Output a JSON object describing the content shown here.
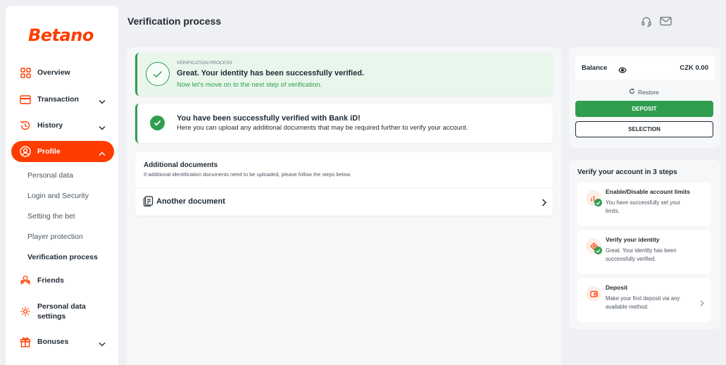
{
  "sidebar": {
    "logo": "Betano",
    "nav": [
      {
        "label": "Overview"
      },
      {
        "label": "Transaction"
      },
      {
        "label": "History"
      },
      {
        "label": "Profile"
      },
      {
        "label": "Friends"
      },
      {
        "label": "Personal data settings"
      },
      {
        "label": "Bonuses"
      }
    ],
    "profile_sub": [
      {
        "label": "Personal data"
      },
      {
        "label": "Login and Security"
      },
      {
        "label": "Setting the bet"
      },
      {
        "label": "Player protection"
      },
      {
        "label": "Verification process"
      }
    ]
  },
  "header": {
    "title": "Verification process",
    "icons": [
      "headset-icon",
      "mail-icon"
    ]
  },
  "main": {
    "banner": {
      "small": "VERIFICATION PROCESS",
      "head": "Great. Your identity has been successfully verified.",
      "sub": "Now let's move on to the next step of verification."
    },
    "bankid": {
      "head": "You have been successfully verified with Bank iD!",
      "sub": "Here you can upload any additional documents that may be required further to verify your account."
    },
    "docs": {
      "head": "Additional documents",
      "sub": "If additional identification documents need to be uploaded, please follow the steps below.",
      "row_label": "Another document"
    }
  },
  "balance": {
    "label": "Balance",
    "value": "CZK 0.00",
    "restore": "Restore",
    "deposit": "DEPOSIT",
    "selection": "SELECTION"
  },
  "steps": {
    "title": "Verify your account in 3 steps",
    "items": [
      {
        "title": "Enable/Disable account limits",
        "desc": "You have successfully set your limits."
      },
      {
        "title": "Verify your identity",
        "desc": "Great. Your identity has been successfully verified."
      },
      {
        "title": "Deposit",
        "desc": "Make your first deposit via any available method."
      }
    ]
  },
  "colors": {
    "brand": "#ff3c00",
    "success": "#2f9e4f",
    "background": "#eef0f3"
  }
}
